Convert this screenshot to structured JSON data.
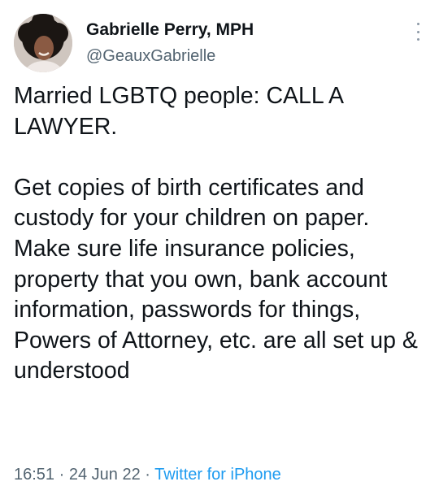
{
  "author": {
    "display_name": "Gabrielle Perry, MPH",
    "handle": "@GeauxGabrielle",
    "avatar_icon": "profile-photo"
  },
  "menu_icon": "more-vertical-icon",
  "tweet": {
    "paragraph_1": "Married LGBTQ people: CALL A LAWYER.",
    "paragraph_2": "Get copies of birth certificates and custody for your children on paper. Make sure life insurance policies, property that you own, bank account information, passwords for things, Powers of Attorney, etc. are all set up & understood"
  },
  "meta": {
    "time": "16:51",
    "separator_1": "·",
    "date": "24 Jun 22",
    "separator_2": "·",
    "source": "Twitter for iPhone"
  },
  "colors": {
    "text": "#0f1419",
    "secondary": "#536471",
    "link": "#1d9bf0"
  }
}
